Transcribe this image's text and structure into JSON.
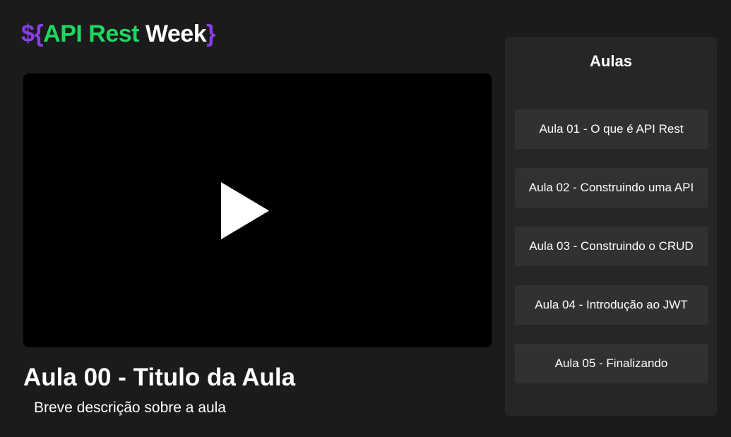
{
  "logo": {
    "open": "${",
    "api_rest": "API Rest",
    "week": "Week",
    "close": "}"
  },
  "player": {
    "play_icon": "play-icon"
  },
  "lesson": {
    "title": "Aula 00 - Titulo da Aula",
    "description": "Breve descrição sobre a aula"
  },
  "sidebar": {
    "title": "Aulas",
    "items": [
      {
        "label": "Aula 01 - O que é API Rest"
      },
      {
        "label": "Aula 02 - Construindo uma API"
      },
      {
        "label": "Aula 03 - Construindo o CRUD"
      },
      {
        "label": "Aula 04 - Introdução ao JWT"
      },
      {
        "label": "Aula 05 - Finalizando"
      }
    ]
  },
  "colors": {
    "background": "#1b1b1b",
    "sidebar": "#262628",
    "item": "#313134",
    "brand_purple": "#8a3ee8",
    "brand_green": "#1ed760"
  }
}
